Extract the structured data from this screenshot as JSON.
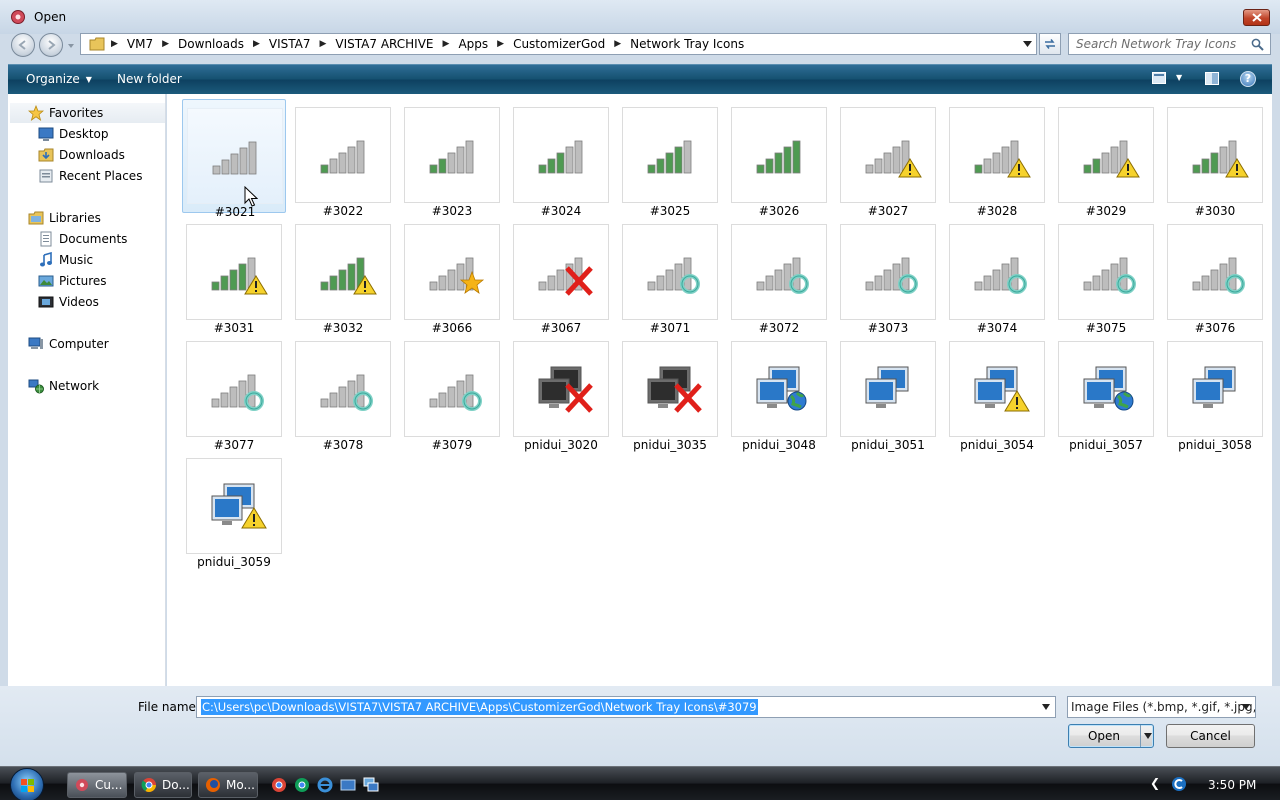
{
  "window": {
    "title": "Open"
  },
  "address": {
    "crumbs": [
      "VM7",
      "Downloads",
      "VISTA7",
      "VISTA7 ARCHIVE",
      "Apps",
      "CustomizerGod",
      "Network Tray Icons"
    ],
    "search_placeholder": "Search Network Tray Icons"
  },
  "toolbar": {
    "organize_label": "Organize",
    "new_folder_label": "New folder"
  },
  "nav": {
    "favorites": "Favorites",
    "desktop": "Desktop",
    "downloads": "Downloads",
    "recent_places": "Recent Places",
    "libraries": "Libraries",
    "documents": "Documents",
    "music": "Music",
    "pictures": "Pictures",
    "videos": "Videos",
    "computer": "Computer",
    "network": "Network"
  },
  "files": [
    {
      "name": "#3021",
      "icon": "signal-bars-1-icon",
      "selected": true
    },
    {
      "name": "#3022",
      "icon": "signal-bars-2-icon"
    },
    {
      "name": "#3023",
      "icon": "signal-bars-3-icon"
    },
    {
      "name": "#3024",
      "icon": "signal-bars-4-icon"
    },
    {
      "name": "#3025",
      "icon": "signal-bars-5-icon"
    },
    {
      "name": "#3026",
      "icon": "signal-bars-6-icon"
    },
    {
      "name": "#3027",
      "icon": "signal-warning-1-icon"
    },
    {
      "name": "#3028",
      "icon": "signal-warning-2-icon"
    },
    {
      "name": "#3029",
      "icon": "signal-warning-3-icon"
    },
    {
      "name": "#3030",
      "icon": "signal-warning-4-icon"
    },
    {
      "name": "#3031",
      "icon": "signal-warning-5-icon"
    },
    {
      "name": "#3032",
      "icon": "signal-warning-6-icon"
    },
    {
      "name": "#3066",
      "icon": "signal-sparkle-icon"
    },
    {
      "name": "#3067",
      "icon": "signal-error-icon"
    },
    {
      "name": "#3071",
      "icon": "signal-busy-icon"
    },
    {
      "name": "#3072",
      "icon": "signal-busy-icon"
    },
    {
      "name": "#3073",
      "icon": "signal-busy-icon"
    },
    {
      "name": "#3074",
      "icon": "signal-busy-icon"
    },
    {
      "name": "#3075",
      "icon": "signal-busy-icon"
    },
    {
      "name": "#3076",
      "icon": "signal-busy-icon"
    },
    {
      "name": "#3077",
      "icon": "signal-busy-icon"
    },
    {
      "name": "#3078",
      "icon": "signal-busy-icon"
    },
    {
      "name": "#3079",
      "icon": "signal-busy-icon"
    },
    {
      "name": "pnidui_3020",
      "icon": "network-disconnected-icon"
    },
    {
      "name": "pnidui_3035",
      "icon": "network-disconnected-icon"
    },
    {
      "name": "pnidui_3048",
      "icon": "network-internet-icon"
    },
    {
      "name": "pnidui_3051",
      "icon": "network-local-icon"
    },
    {
      "name": "pnidui_3054",
      "icon": "network-warning-icon"
    },
    {
      "name": "pnidui_3057",
      "icon": "network-internet-icon"
    },
    {
      "name": "pnidui_3058",
      "icon": "network-local-icon"
    },
    {
      "name": "pnidui_3059",
      "icon": "network-warning-icon"
    }
  ],
  "footer": {
    "file_name_label": "File name:",
    "file_name_value": "C:\\Users\\pc\\Downloads\\VISTA7\\VISTA7 ARCHIVE\\Apps\\CustomizerGod\\Network Tray Icons\\#3079",
    "filter_value": "Image Files (*.bmp, *.gif, *.jpg,",
    "open_label": "Open",
    "cancel_label": "Cancel"
  },
  "taskbar": {
    "items": [
      "Cu...",
      "Do...",
      "Mo..."
    ],
    "clock": "3:50 PM"
  },
  "colors": {
    "toolbar": "#14506f",
    "selection": "#3399ff",
    "signal_green": "#4f9a52",
    "warning": "#f6d22c",
    "error": "#e0201a"
  }
}
